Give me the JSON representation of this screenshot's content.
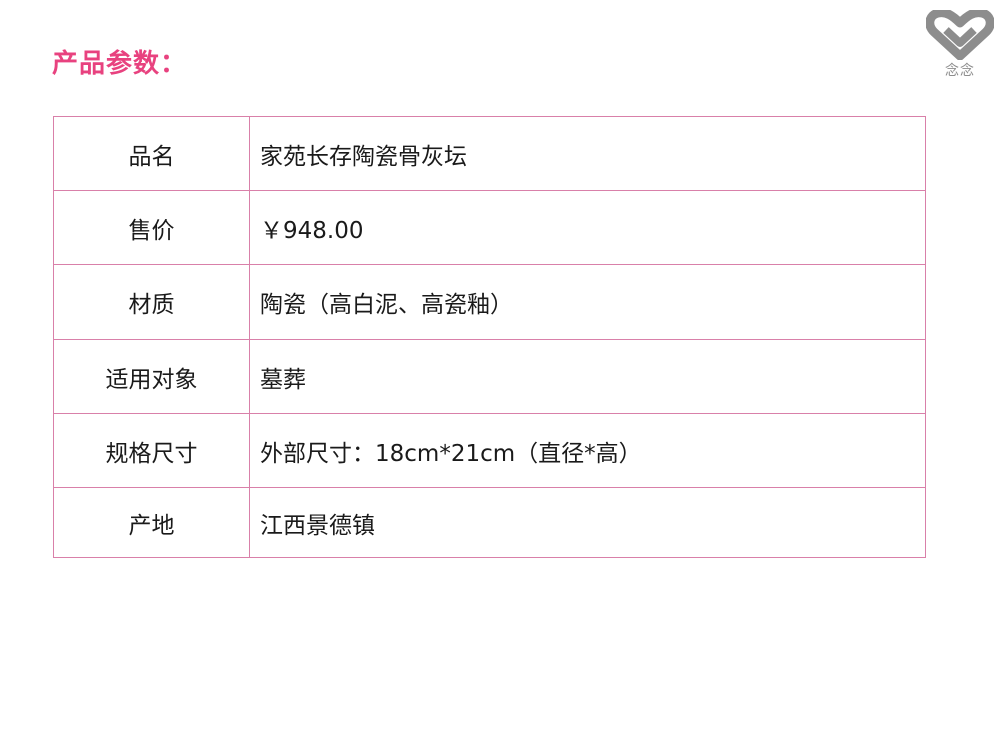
{
  "header": {
    "title": "产品参数："
  },
  "brand": {
    "icon": "heart-logo-icon",
    "name": "念念",
    "color": "#8d8d8d"
  },
  "accent_color": "#e8427f",
  "border_color": "#d980a9",
  "params": [
    {
      "label": "品名",
      "value": "家苑长存陶瓷骨灰坛"
    },
    {
      "label": "售价",
      "value": "￥948.00"
    },
    {
      "label": "材质",
      "value": "陶瓷（高白泥、高瓷釉）"
    },
    {
      "label": "适用对象",
      "value": "墓葬"
    },
    {
      "label": "规格尺寸",
      "value": "外部尺寸：18cm*21cm（直径*高）"
    },
    {
      "label": "产地",
      "value": "江西景德镇"
    }
  ]
}
